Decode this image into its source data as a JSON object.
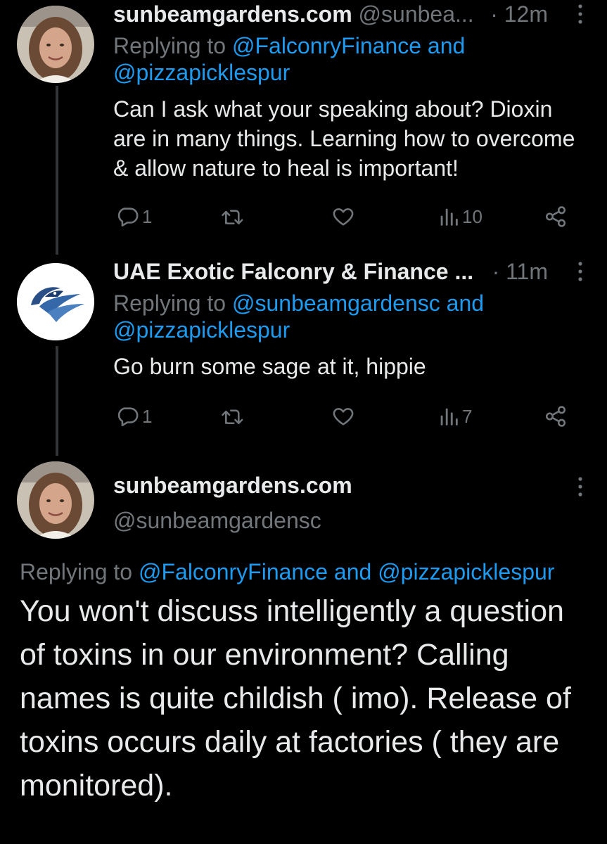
{
  "tweets": [
    {
      "name": "sunbeamgardens.com",
      "handle": "@sunbea...",
      "time": "· 12m",
      "replying_prefix": "Replying to ",
      "replying_user1": "@FalconryFinance",
      "replying_and": " and",
      "replying_user2": "@pizzapicklespur",
      "text": "Can I ask what your speaking about? Dioxin are in many things. Learning how to overcome & allow nature to heal is important!",
      "replies": "1",
      "views": "10"
    },
    {
      "name": "UAE Exotic Falconry & Finance ...",
      "time": "· 11m",
      "replying_prefix": "Replying to ",
      "replying_user1": "@sunbeamgardensc",
      "replying_and": " and",
      "replying_user2": "@pizzapicklespur",
      "text": "Go burn some sage at it, hippie",
      "replies": "1",
      "views": "7"
    }
  ],
  "main_tweet": {
    "name": "sunbeamgardens.com",
    "handle": "@sunbeamgardensc",
    "replying_prefix": "Replying to ",
    "replying_user1": "@FalconryFinance",
    "replying_and": " and ",
    "replying_user2": "@pizzapicklespur",
    "text": "You won't discuss intelligently a question of toxins in our environment? Calling names is quite childish ( imo). Release of toxins occurs daily at factories ( they are monitored)."
  },
  "colors": {
    "background": "#000000",
    "text": "#e7e9ea",
    "secondary": "#71767b",
    "link": "#1d9bf0"
  }
}
